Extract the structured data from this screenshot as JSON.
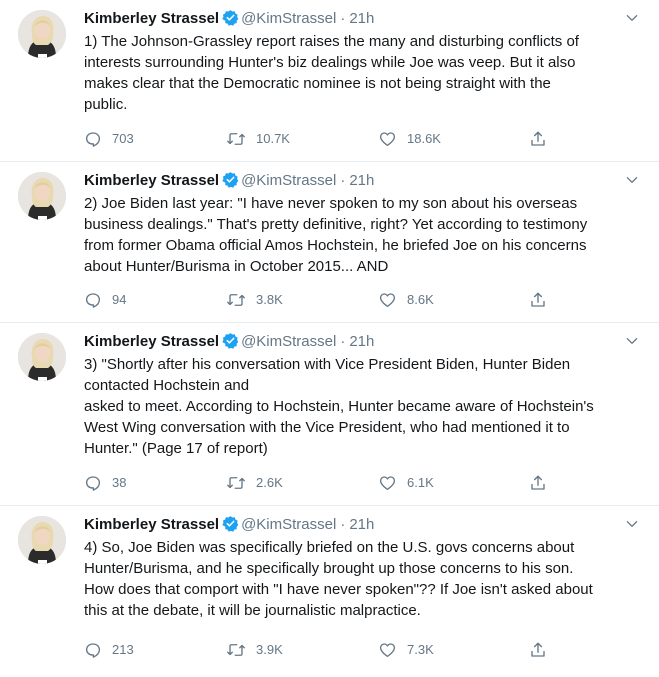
{
  "tweets": [
    {
      "name": "Kimberley Strassel",
      "handle": "@KimStrassel",
      "separator": "·",
      "time": "21h",
      "text": "1) The Johnson-Grassley report raises the many and disturbing conflicts of\ninterests surrounding Hunter's biz dealings while Joe was veep. But it also\nmakes clear that the Democratic nominee is not being straight with the\npublic.",
      "replies": "703",
      "retweets": "10.7K",
      "likes": "18.6K"
    },
    {
      "name": "Kimberley Strassel",
      "handle": "@KimStrassel",
      "separator": "·",
      "time": "21h",
      "text": "2) Joe Biden last year: \"I have never spoken to my son about his overseas\nbusiness dealings.\" That's pretty definitive, right? Yet according to testimony\nfrom former Obama official Amos Hochstein, he briefed Joe on his concerns\nabout Hunter/Burisma in October 2015... AND",
      "replies": "94",
      "retweets": "3.8K",
      "likes": "8.6K"
    },
    {
      "name": "Kimberley Strassel",
      "handle": "@KimStrassel",
      "separator": "·",
      "time": "21h",
      "text": "3) \"Shortly after his conversation with Vice President Biden, Hunter Biden\ncontacted Hochstein and\nasked to meet. According to Hochstein, Hunter became aware of Hochstein's\nWest Wing conversation with the Vice President, who had mentioned it to\nHunter.\" (Page 17 of report)",
      "replies": "38",
      "retweets": "2.6K",
      "likes": "6.1K"
    },
    {
      "name": "Kimberley Strassel",
      "handle": "@KimStrassel",
      "separator": "·",
      "time": "21h",
      "text": "4) So, Joe Biden was specifically briefed on the U.S. govs concerns about\nHunter/Burisma, and he specifically brought up those concerns to his son.\nHow does that comport with \"I have never spoken\"?? If Joe isn't asked about\nthis at the debate, it will be journalistic malpractice.",
      "replies": "213",
      "retweets": "3.9K",
      "likes": "7.3K"
    }
  ],
  "colors": {
    "text": "#14171a",
    "secondary": "#657786",
    "verified": "#1da1f2",
    "divider": "#e6ecf0"
  },
  "icons": [
    "verified-badge-icon",
    "chevron-down-icon",
    "reply-icon",
    "retweet-icon",
    "like-icon",
    "share-icon"
  ]
}
